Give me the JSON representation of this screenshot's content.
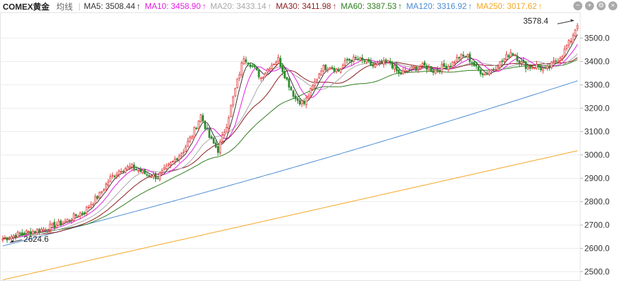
{
  "chart_data": {
    "type": "candlestick",
    "title": "COMEX黄金",
    "mode_label": "均线",
    "y_range": [
      2460,
      3610
    ],
    "y_ticks": [
      2500,
      2600,
      2700,
      2800,
      2900,
      3000,
      3100,
      3200,
      3300,
      3400,
      3500
    ],
    "grid": true,
    "legend_position": "top-left",
    "legend": [
      {
        "key": "MA5",
        "label": "MA5: 3508.44",
        "arrow": "↑",
        "color": "#333333"
      },
      {
        "key": "MA10",
        "label": "MA10: 3458.90",
        "arrow": "↑",
        "color": "#e31ce4"
      },
      {
        "key": "MA20",
        "label": "MA20: 3433.14",
        "arrow": "↑",
        "color": "#a8a8a8"
      },
      {
        "key": "MA30",
        "label": "MA30: 3411.98",
        "arrow": "↑",
        "color": "#8b1a1a"
      },
      {
        "key": "MA60",
        "label": "MA60: 3387.53",
        "arrow": "↑",
        "color": "#2f7d1e"
      },
      {
        "key": "MA120",
        "label": "MA120: 3316.92",
        "arrow": "↑",
        "color": "#4a8ad3"
      },
      {
        "key": "MA250",
        "label": "MA250: 3017.62",
        "arrow": "↑",
        "color": "#f5a623"
      }
    ],
    "annotations": [
      {
        "text": "3578.4",
        "type": "max",
        "value": 3578.4
      },
      {
        "text": "2624.6",
        "type": "min",
        "value": 2624.6
      }
    ],
    "trend_points": [
      [
        0,
        2640
      ],
      [
        8,
        2662
      ],
      [
        18,
        2680
      ],
      [
        28,
        2710
      ],
      [
        38,
        2760
      ],
      [
        45,
        2830
      ],
      [
        50,
        2900
      ],
      [
        55,
        2940
      ],
      [
        60,
        2948
      ],
      [
        66,
        2920
      ],
      [
        72,
        2905
      ],
      [
        78,
        2960
      ],
      [
        84,
        3020
      ],
      [
        88,
        3085
      ],
      [
        92,
        3170
      ],
      [
        96,
        3075
      ],
      [
        100,
        3020
      ],
      [
        104,
        3130
      ],
      [
        108,
        3280
      ],
      [
        112,
        3420
      ],
      [
        116,
        3380
      ],
      [
        120,
        3330
      ],
      [
        124,
        3380
      ],
      [
        128,
        3410
      ],
      [
        132,
        3320
      ],
      [
        136,
        3240
      ],
      [
        140,
        3220
      ],
      [
        144,
        3290
      ],
      [
        148,
        3370
      ],
      [
        152,
        3380
      ],
      [
        156,
        3360
      ],
      [
        160,
        3405
      ],
      [
        164,
        3410
      ],
      [
        168,
        3400
      ],
      [
        172,
        3380
      ],
      [
        176,
        3390
      ],
      [
        180,
        3395
      ],
      [
        184,
        3345
      ],
      [
        188,
        3360
      ],
      [
        192,
        3375
      ],
      [
        196,
        3380
      ],
      [
        200,
        3360
      ],
      [
        204,
        3375
      ],
      [
        208,
        3385
      ],
      [
        212,
        3420
      ],
      [
        216,
        3420
      ],
      [
        220,
        3370
      ],
      [
        224,
        3345
      ],
      [
        228,
        3370
      ],
      [
        232,
        3400
      ],
      [
        236,
        3440
      ],
      [
        238,
        3430
      ],
      [
        240,
        3400
      ],
      [
        244,
        3375
      ],
      [
        248,
        3382
      ],
      [
        252,
        3360
      ],
      [
        256,
        3395
      ],
      [
        260,
        3430
      ],
      [
        262,
        3465
      ],
      [
        264,
        3492
      ],
      [
        266,
        3540
      ],
      [
        267,
        3562
      ]
    ],
    "ma120_start": 2610,
    "ma120_end": 3316.92,
    "ma250_start": 2465,
    "ma250_end": 3017.62,
    "ma60_start": 2665,
    "ma60_end": 3387.53,
    "candle_count": 268
  }
}
